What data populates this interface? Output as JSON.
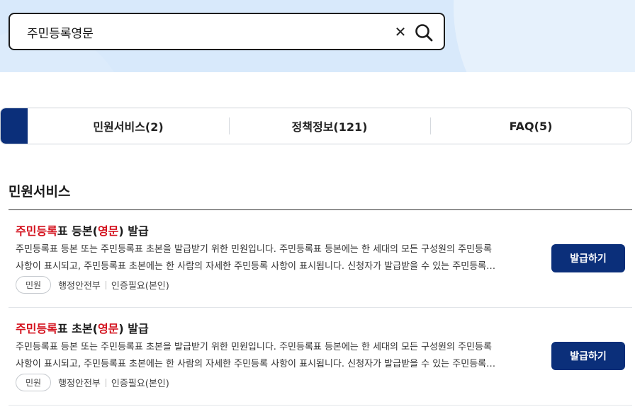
{
  "search": {
    "value": "주민등록영문",
    "clear_icon": "close-icon",
    "search_icon": "search-icon"
  },
  "tabs": [
    {
      "label": "민원서비스(2)",
      "active": true
    },
    {
      "label": "정책정보(121)",
      "active": false
    },
    {
      "label": "FAQ(5)",
      "active": false
    }
  ],
  "section": {
    "title": "민원서비스"
  },
  "results": [
    {
      "title_hl1": "주민등록",
      "title_mid1": "표 등본(",
      "title_hl2": "영문",
      "title_mid2": ") 발급",
      "desc_line1": "주민등록표 등본 또는 주민등록표 초본을 발급받기 위한 민원입니다. 주민등록표 등본에는 한 세대의 모든 구성원의 주민등록",
      "desc_line2": "사항이 표시되고, 주민등록표 초본에는 한 사람의 자세한 주민등록 사항이 표시됩니다. 신청자가 발급받을 수 있는 주민등록…",
      "tag": "민원",
      "agency": "행정안전부",
      "auth": "인증필요(본인)",
      "button": "발급하기"
    },
    {
      "title_hl1": "주민등록",
      "title_mid1": "표 초본(",
      "title_hl2": "영문",
      "title_mid2": ") 발급",
      "desc_line1": "주민등록표 등본 또는 주민등록표 초본을 발급받기 위한 민원입니다. 주민등록표 등본에는 한 세대의 모든 구성원의 주민등록",
      "desc_line2": "사항이 표시되고, 주민등록표 초본에는 한 사람의 자세한 주민등록 사항이 표시됩니다. 신청자가 발급받을 수 있는 주민등록…",
      "tag": "민원",
      "agency": "행정안전부",
      "auth": "인증필요(본인)",
      "button": "발급하기"
    }
  ],
  "colors": {
    "accent": "#0b2f7a",
    "highlight": "#d4121e",
    "banner": "#d8e9fb"
  }
}
